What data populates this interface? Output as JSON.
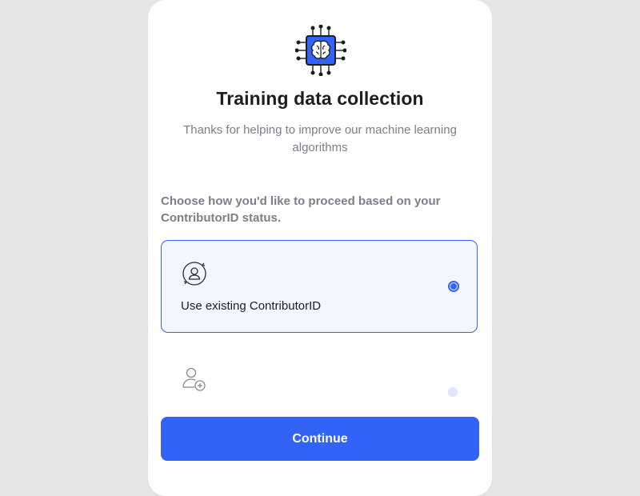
{
  "header": {
    "logo_icon": "ai-brain-chip-icon",
    "title": "Training data collection",
    "subtitle": "Thanks for helping to improve our machine learning algorithms"
  },
  "prompt": "Choose how you'd like to proceed based on your ContributorID status.",
  "options": [
    {
      "icon": "user-sync-icon",
      "label": "Use existing ContributorID",
      "selected": true
    },
    {
      "icon": "add-user-icon",
      "label": "",
      "selected": false
    }
  ],
  "actions": {
    "continue_label": "Continue"
  },
  "colors": {
    "accent": "#3362f6",
    "selected_bg": "#f3f6fe",
    "page_bg": "#e6e6e6",
    "muted_text": "#7b7f8a",
    "title_text": "#1c1d21"
  }
}
